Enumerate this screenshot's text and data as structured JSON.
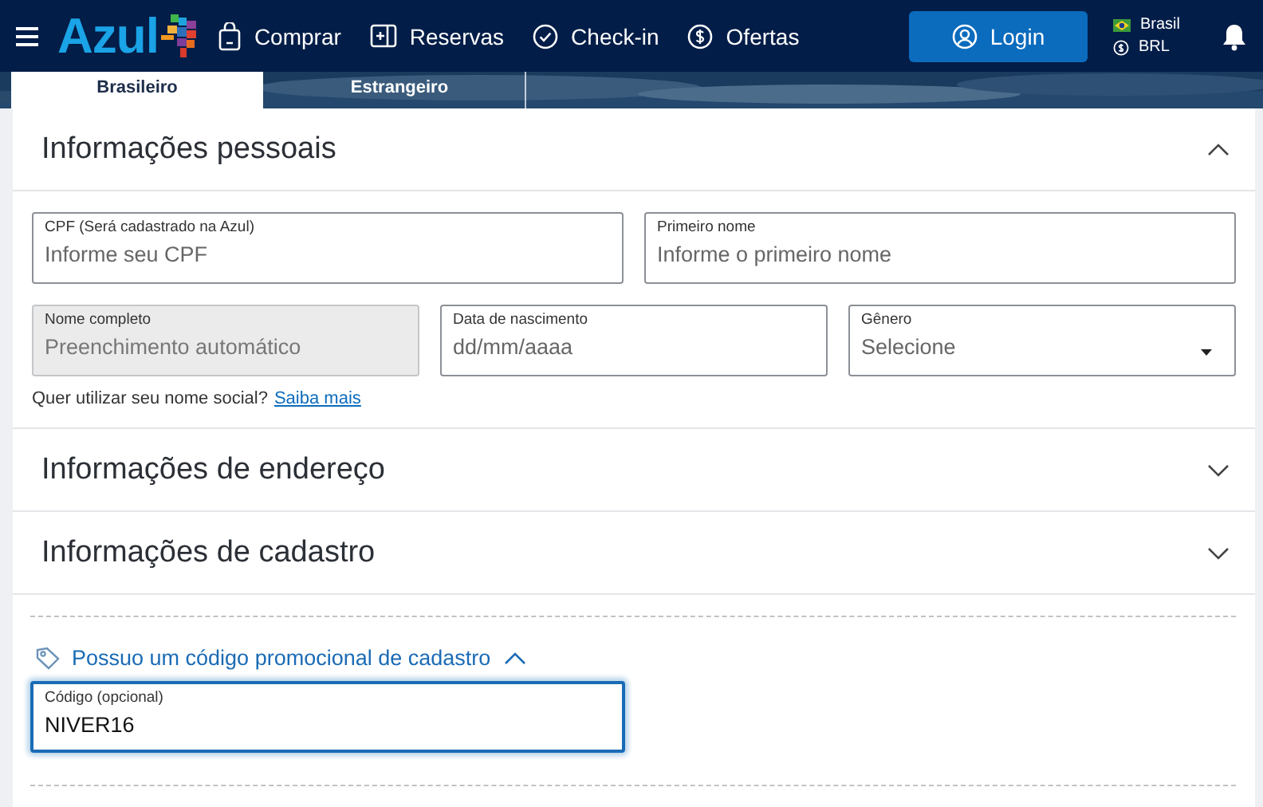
{
  "nav": {
    "logo": "Azul",
    "items": [
      {
        "label": "Comprar",
        "kind": "shop"
      },
      {
        "label": "Reservas",
        "kind": "bookings"
      },
      {
        "label": "Check-in",
        "kind": "checkin"
      },
      {
        "label": "Ofertas",
        "kind": "offers"
      }
    ],
    "login": "Login",
    "country": "Brasil",
    "currency": "BRL"
  },
  "tabs": [
    {
      "label": "Brasileiro",
      "selected": true
    },
    {
      "label": "Estrangeiro",
      "selected": false
    }
  ],
  "sections": [
    {
      "title": "Informações pessoais",
      "expanded": true
    },
    {
      "title": "Informações de endereço",
      "expanded": false
    },
    {
      "title": "Informações de cadastro",
      "expanded": false
    }
  ],
  "field_rows": [
    [
      {
        "label": "CPF (Será cadastrado na Azul)",
        "placeholder": "Informe seu CPF",
        "kind": "text",
        "disabled": false
      },
      {
        "label": "Primeiro nome",
        "placeholder": "Informe o primeiro nome",
        "kind": "text",
        "disabled": false
      }
    ],
    [
      {
        "label": "Nome completo",
        "placeholder": "Preenchimento automático",
        "kind": "text",
        "disabled": true
      },
      {
        "label": "Data de nascimento",
        "placeholder": "dd/mm/aaaa",
        "kind": "text",
        "disabled": false
      },
      {
        "label": "Gênero",
        "placeholder": "Selecione",
        "kind": "select",
        "disabled": false
      }
    ]
  ],
  "social_name": {
    "text": "Quer utilizar seu nome social?",
    "link": "Saiba mais"
  },
  "promo": {
    "label": "Possuo um código promocional de cadastro",
    "expanded": true,
    "field": {
      "label": "Código (opcional)",
      "value": "NIVER16",
      "focused": true
    }
  }
}
